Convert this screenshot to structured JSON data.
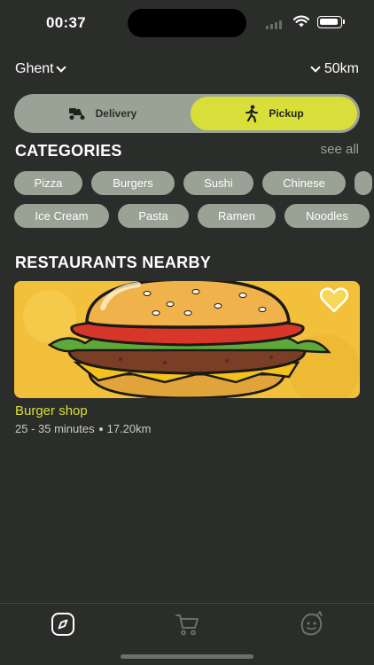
{
  "status": {
    "time": "00:37"
  },
  "location": {
    "city": "Ghent",
    "range": "50km"
  },
  "mode_toggle": {
    "delivery_label": "Delivery",
    "pickup_label": "Pickup",
    "selected": "Pickup",
    "accent_color": "#d9df3a"
  },
  "categories": {
    "title": "CATEGORIES",
    "see_all": "see all",
    "row1": [
      "Pizza",
      "Burgers",
      "Sushi",
      "Chinese"
    ],
    "row2": [
      "Ice Cream",
      "Pasta",
      "Ramen",
      "Noodles"
    ]
  },
  "restaurants": {
    "title": "RESTAURANTS NEARBY",
    "items": [
      {
        "name": "Burger shop",
        "time": "25 - 35 minutes",
        "distance": "17.20km",
        "favorite_icon": "heart-icon"
      }
    ]
  },
  "tabbar": {
    "icons": [
      "compass-icon",
      "cart-icon",
      "profile-icon"
    ],
    "active": "compass-icon"
  }
}
